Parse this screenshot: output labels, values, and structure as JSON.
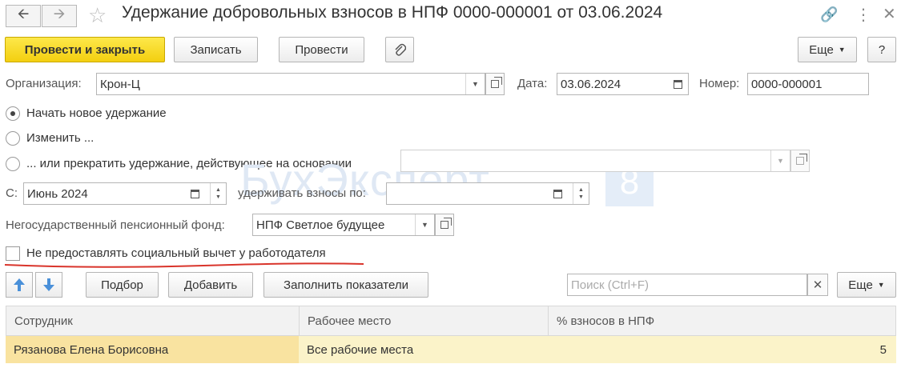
{
  "window": {
    "title": "Удержание добровольных взносов в НПФ 0000-000001 от 03.06.2024",
    "back_icon": "arrow-left-icon",
    "forward_icon": "arrow-right-icon",
    "star_icon": "star-icon",
    "link_icon": "link-icon",
    "menu_icon": "more-vertical-icon",
    "close_icon": "close-icon"
  },
  "toolbar": {
    "post_close": "Провести и закрыть",
    "save": "Записать",
    "post": "Провести",
    "more": "Еще",
    "help": "?"
  },
  "header": {
    "org_label": "Организация:",
    "org_value": "Крон-Ц",
    "date_label": "Дата:",
    "date_value": "03.06.2024",
    "number_label": "Номер:",
    "number_value": "0000-000001"
  },
  "mode": {
    "opt_new": "Начать новое удержание",
    "opt_change": "Изменить ...",
    "opt_stop": "... или прекратить удержание, действующее на основании",
    "selected": "opt_new"
  },
  "period": {
    "from_label": "С:",
    "from_value": "Июнь 2024",
    "to_label": "удерживать взносы по:",
    "to_value": ""
  },
  "fund": {
    "label": "Негосударственный пенсионный фонд:",
    "value": "НПФ Светлое будущее"
  },
  "deduction": {
    "label": "Не предоставлять социальный вычет у работодателя",
    "checked": false
  },
  "table_toolbar": {
    "pick": "Подбор",
    "add": "Добавить",
    "fill": "Заполнить показатели",
    "search_placeholder": "Поиск (Ctrl+F)",
    "more": "Еще"
  },
  "table": {
    "columns": [
      "Сотрудник",
      "Рабочее место",
      "% взносов в НПФ"
    ],
    "rows": [
      [
        "Рязанова Елена Борисовна",
        "Все рабочие места",
        "5"
      ]
    ]
  },
  "watermark": {
    "text": "БухЭксперт",
    "badge": "8"
  },
  "colors": {
    "primary_button": "#f5d31c",
    "underline": "#d9342b",
    "selected_row": "#fbf3c9"
  }
}
